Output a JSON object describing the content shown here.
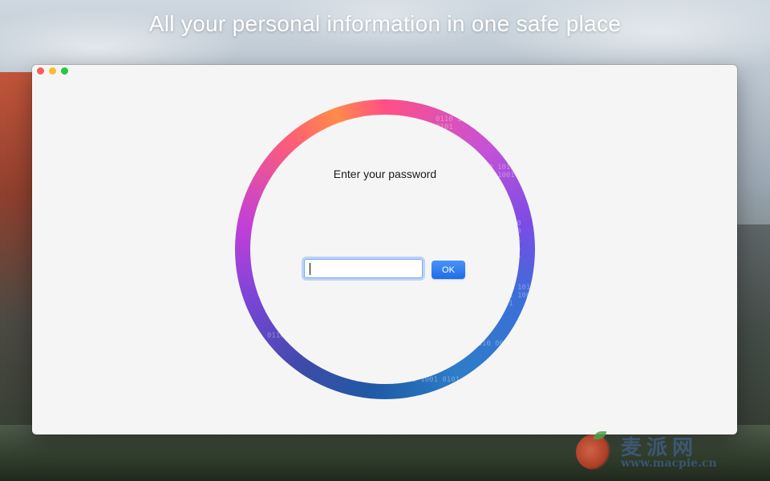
{
  "headline": "All your personal information in one safe place",
  "window": {
    "traffic_lights": [
      "close",
      "minimize",
      "zoom"
    ]
  },
  "login": {
    "prompt": "Enter your password",
    "password_value": "",
    "ok_label": "OK"
  },
  "ring": {
    "digit_pattern": "0110 1010 0011 1001 0101"
  },
  "watermark": {
    "title": "麦派网",
    "url": "www.macpie.cn"
  },
  "colors": {
    "ok_button": "#1c6ee8",
    "input_focus_ring": "#7aa9ee",
    "window_background": "#f5f5f5"
  }
}
